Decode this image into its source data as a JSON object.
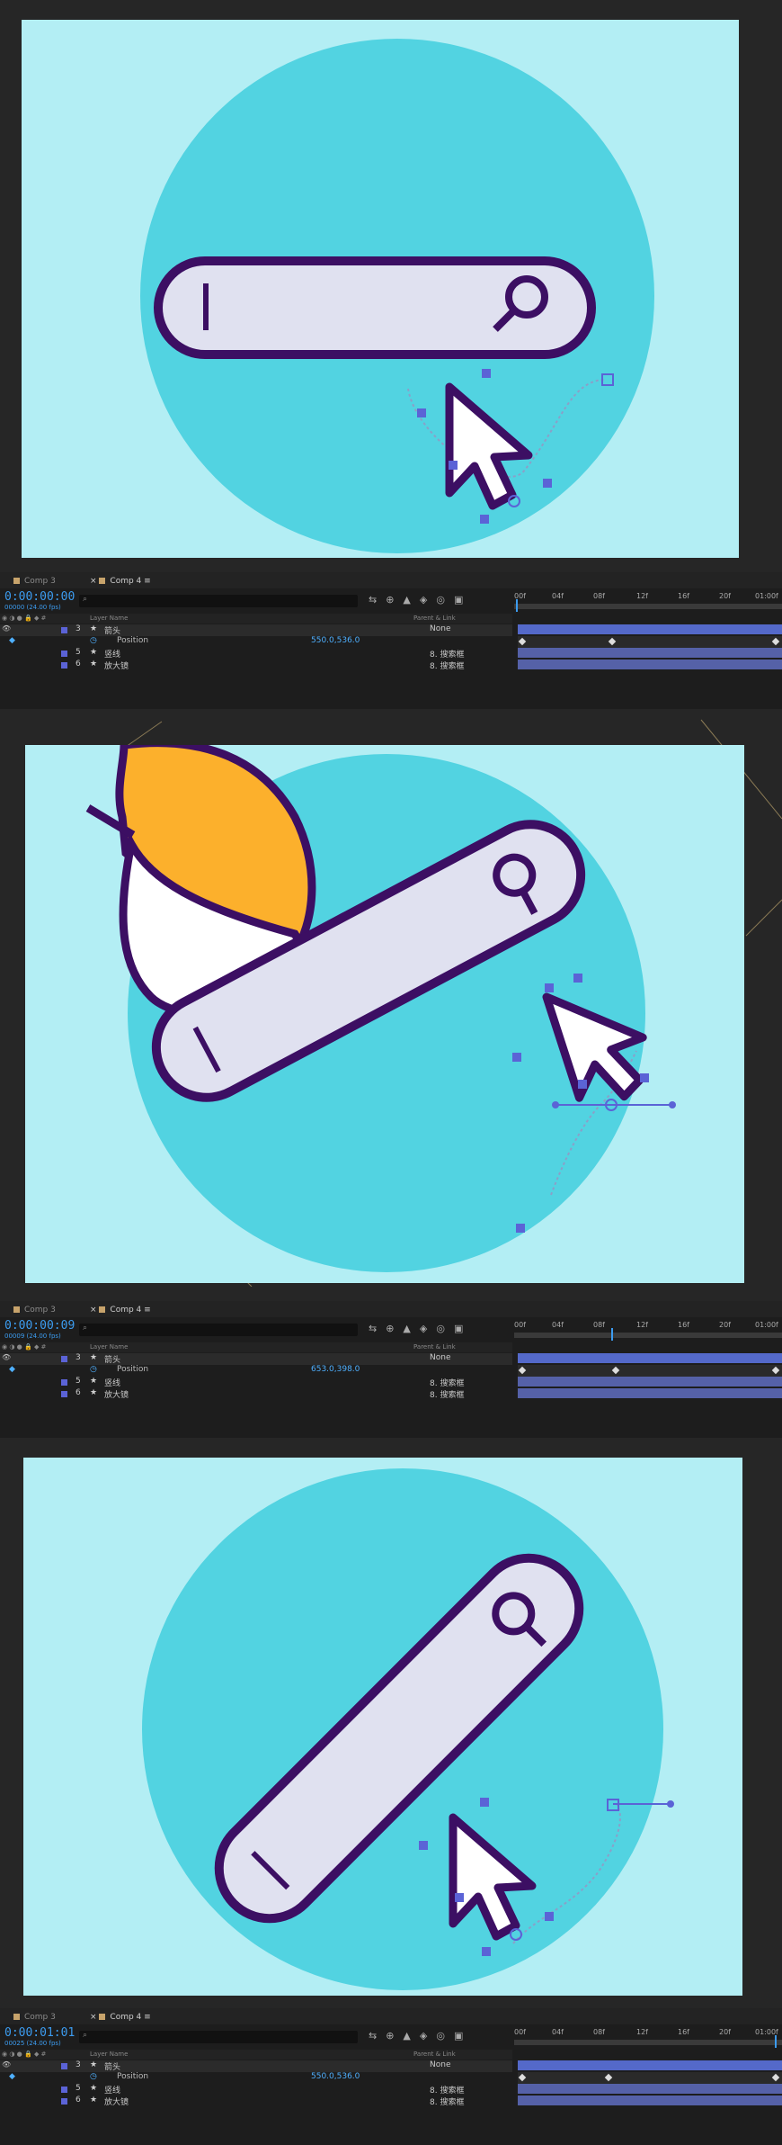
{
  "panels": [
    {
      "timeline": {
        "tabs": [
          "Comp 3",
          "Comp 4"
        ],
        "timecode": "0:00:00:00",
        "timecode_sub": "00000 (24.00 fps)",
        "ruler_labels": [
          "00f",
          "04f",
          "08f",
          "12f",
          "16f",
          "20f",
          "01:00f"
        ],
        "header": {
          "layer_name": "Layer Name",
          "parent": "Parent & Link"
        },
        "layers": [
          {
            "num": "3",
            "name": "箭头",
            "parent": "None",
            "selected": true
          },
          {
            "prop": "Position",
            "value": "550.0,536.0"
          },
          {
            "num": "5",
            "name": "竖线",
            "parent": "8. 搜索框"
          },
          {
            "num": "6",
            "name": "放大镜",
            "parent": "8. 搜索框"
          }
        ]
      }
    },
    {
      "timeline": {
        "tabs": [
          "Comp 3",
          "Comp 4"
        ],
        "timecode": "0:00:00:09",
        "timecode_sub": "00009 (24.00 fps)",
        "ruler_labels": [
          "00f",
          "04f",
          "08f",
          "12f",
          "16f",
          "20f",
          "01:00f"
        ],
        "header": {
          "layer_name": "Layer Name",
          "parent": "Parent & Link"
        },
        "layers": [
          {
            "num": "3",
            "name": "箭头",
            "parent": "None",
            "selected": true
          },
          {
            "prop": "Position",
            "value": "653.0,398.0"
          },
          {
            "num": "5",
            "name": "竖线",
            "parent": "8. 搜索框"
          },
          {
            "num": "6",
            "name": "放大镜",
            "parent": "8. 搜索框"
          }
        ]
      }
    },
    {
      "timeline": {
        "tabs": [
          "Comp 3",
          "Comp 4"
        ],
        "timecode": "0:00:01:01",
        "timecode_sub": "00025 (24.00 fps)",
        "ruler_labels": [
          "00f",
          "04f",
          "08f",
          "12f",
          "16f",
          "20f",
          "01:00f"
        ],
        "header": {
          "layer_name": "Layer Name",
          "parent": "Parent & Link"
        },
        "layers": [
          {
            "num": "3",
            "name": "箭头",
            "parent": "None",
            "selected": true
          },
          {
            "prop": "Position",
            "value": "550.0,536.0"
          },
          {
            "num": "5",
            "name": "竖线",
            "parent": "8. 搜索框"
          },
          {
            "num": "6",
            "name": "放大镜",
            "parent": "8. 搜索框"
          }
        ]
      }
    }
  ],
  "colors": {
    "canvas_bg": "#b3eef4",
    "circle": "#52d3e1",
    "searchbar_fill": "#e0e1f0",
    "outline": "#3c0f63",
    "hand_orange": "#fcb02c",
    "layer_bar": "#5561a8",
    "timecode_blue": "#3c9cf0"
  }
}
